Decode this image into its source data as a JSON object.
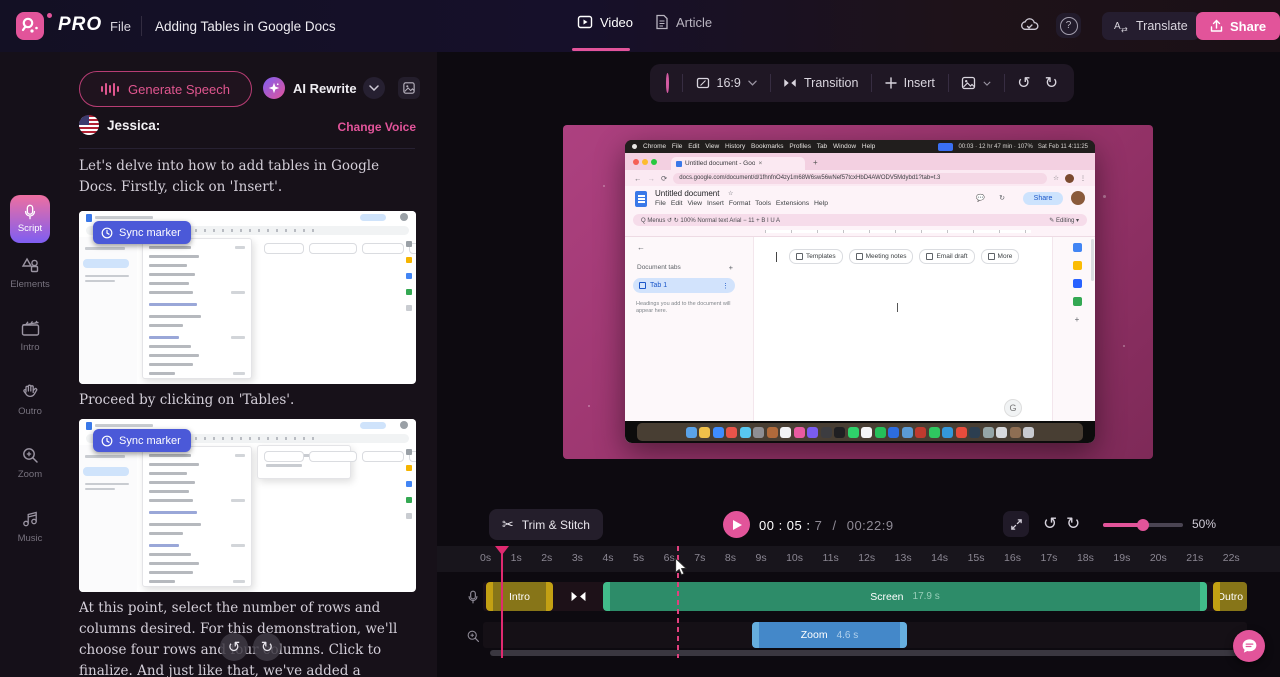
{
  "topbar": {
    "logo_text": "PRO",
    "file_menu": "File",
    "project_title": "Adding Tables in Google Docs",
    "tab_video": "Video",
    "tab_article": "Article",
    "help_label": "?",
    "translate_label": "Translate",
    "share_label": "Share"
  },
  "sidebar": {
    "items": [
      {
        "label": "Script",
        "icon": "microphone-icon",
        "active": true
      },
      {
        "label": "Elements",
        "icon": "shapes-icon",
        "active": false
      },
      {
        "label": "Intro",
        "icon": "clapperboard-icon",
        "active": false
      },
      {
        "label": "Outro",
        "icon": "waving-hand-icon",
        "active": false
      },
      {
        "label": "Zoom",
        "icon": "magnifier-plus-icon",
        "active": false
      },
      {
        "label": "Music",
        "icon": "music-notes-icon",
        "active": false
      }
    ]
  },
  "script_panel": {
    "generate_speech": "Generate Speech",
    "ai_rewrite": "AI Rewrite",
    "speaker": "Jessica:",
    "change_voice": "Change Voice",
    "paragraph1": "Let's delve into how to add tables in Google Docs. Firstly, click on 'Insert'.",
    "sync_marker1": "Sync marker",
    "caption1": "Proceed by clicking on 'Tables'.",
    "sync_marker2": "Sync marker",
    "paragraph2": "At this point, select the number of rows and columns desired. For this demonstration, we'll choose four rows and four columns. Click to finalize. And just like that, we've added a"
  },
  "canvas_toolbar": {
    "background_color": "#d45ba2",
    "aspect_ratio": "16:9",
    "transition": "Transition",
    "insert": "Insert"
  },
  "preview": {
    "mac_menus": "Chrome File Edit View History Bookmarks Profiles Tab Window Help",
    "mac_status": "00:03 · 12 hr 47 min · 107%",
    "mac_clock": "Sat Feb 11 4:11:25",
    "tab_title": "Untitled document - Goo",
    "url": "docs.google.com/document/d/1fhnfnO4zy1m68W6sw56wNef57tcxHbD4AWODV5Mdybd1?tab=t.3",
    "doc_title": "Untitled document",
    "doc_star": "☆",
    "doc_menus": "File Edit View Insert Format Tools Extensions Help",
    "toolbar_text": "Q Menus    ↺ ↻    100%    Normal text    Arial    − 11 +    B I U A",
    "editing_label": "✎ Editing ▾",
    "share_label": "Share",
    "sidebar_title": "Document tabs",
    "tab1_label": "Tab 1",
    "sidebar_hint": "Headings you add to the document will appear here.",
    "chips": [
      "Templates",
      "Meeting notes",
      "Email draft",
      "More"
    ],
    "g_badge": "G",
    "dock_colors": [
      "#5aa2e8",
      "#f0c04a",
      "#3f8cff",
      "#e8544a",
      "#58c7f0",
      "#8e8e93",
      "#b06a3b",
      "#f2f2f5",
      "#e85aa0",
      "#7a5cf0",
      "#3c3c40",
      "#1f1f22",
      "#2fd06a",
      "#f5f5f7",
      "#25c05a",
      "#2d6cdf",
      "#5b9bd5",
      "#c03a2e",
      "#2fc760",
      "#3498db",
      "#e74c3c",
      "#2c3e50",
      "#95a5a6",
      "#d7d9dd",
      "#8e6e53",
      "#c8cad0"
    ]
  },
  "player": {
    "trim_stitch": "Trim & Stitch",
    "current_time": "00 : 05 :",
    "current_frame": "7",
    "time_separator": "/",
    "total_time": "00:22:9",
    "zoom_level": "50%"
  },
  "timeline": {
    "ticks": [
      "0s",
      "1s",
      "2s",
      "3s",
      "4s",
      "5s",
      "6s",
      "7s",
      "8s",
      "9s",
      "10s",
      "11s",
      "12s",
      "13s",
      "14s",
      "15s",
      "16s",
      "17s",
      "18s",
      "19s",
      "20s",
      "21s",
      "22s"
    ],
    "clips": {
      "intro": {
        "label": "Intro"
      },
      "screen": {
        "label": "Screen",
        "duration": "17.9 s"
      },
      "outro": {
        "label": "Outro"
      },
      "zoom": {
        "label": "Zoom",
        "duration": "4.6 s"
      }
    }
  },
  "colors": {
    "accent_pink": "#e2549a",
    "clip_yellow": "#877518",
    "clip_yellow_handle": "#c3a013",
    "clip_green": "#2d8c69",
    "clip_green_handle": "#41bc8a",
    "clip_blue": "#4488c9",
    "clip_blue_handle": "#66aede",
    "sync_marker_blue": "#4b59d8",
    "playhead": "#e02a70"
  }
}
